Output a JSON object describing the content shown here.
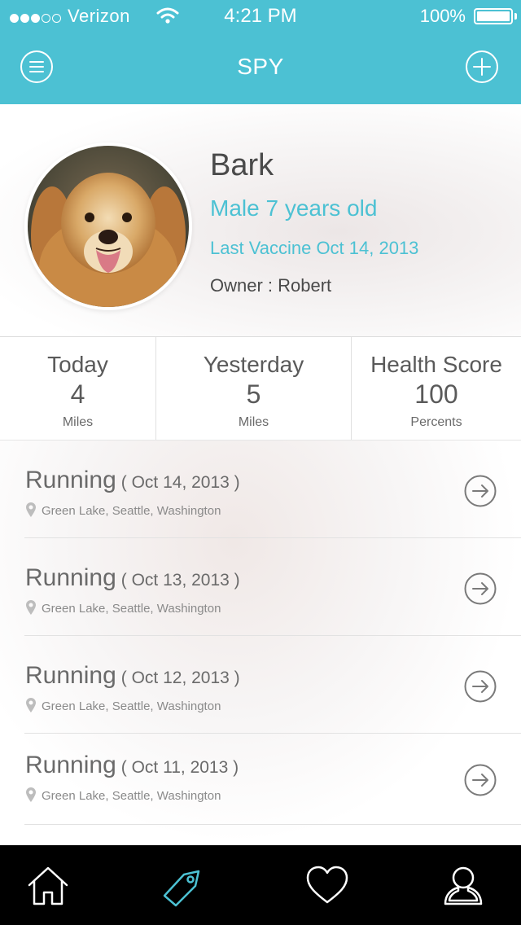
{
  "status_bar": {
    "carrier": "Verizon",
    "signal_dots_filled": 3,
    "signal_dots_total": 5,
    "time": "4:21 PM",
    "battery": "100%"
  },
  "nav": {
    "title": "SPY",
    "menu_icon": "hamburger-circle-icon",
    "add_icon": "plus-circle-icon"
  },
  "profile": {
    "name": "Bark",
    "sex_age": "Male 7 years old",
    "vaccine": "Last Vaccine Oct 14, 2013",
    "owner": "Owner : Robert"
  },
  "stats": [
    {
      "label": "Today",
      "value": "4",
      "unit": "Miles"
    },
    {
      "label": "Yesterday",
      "value": "5",
      "unit": "Miles"
    },
    {
      "label": "Health Score",
      "value": "100",
      "unit": "Percents"
    }
  ],
  "activities": [
    {
      "activity": "Running",
      "date": "( Oct 14, 2013 )",
      "location": "Green Lake, Seattle, Washington"
    },
    {
      "activity": "Running",
      "date": "( Oct 13, 2013 )",
      "location": "Green Lake, Seattle, Washington"
    },
    {
      "activity": "Running",
      "date": "( Oct 12, 2013 )",
      "location": "Green Lake, Seattle, Washington"
    },
    {
      "activity": "Running",
      "date": "( Oct 11, 2013 )",
      "location": "Green Lake, Seattle, Washington"
    }
  ],
  "tabbar": {
    "tabs": [
      {
        "icon": "home-icon",
        "active": false
      },
      {
        "icon": "tag-icon",
        "active": true
      },
      {
        "icon": "heart-icon",
        "active": false
      },
      {
        "icon": "user-icon",
        "active": false
      }
    ]
  },
  "colors": {
    "accent": "#4cc1d3",
    "text": "#4a4a4a",
    "tabbar": "#000000"
  }
}
